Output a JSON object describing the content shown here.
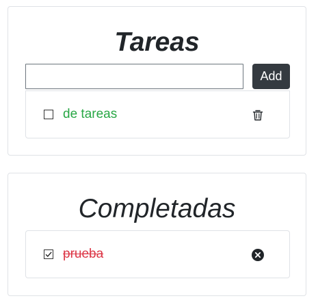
{
  "pending": {
    "title": "Tareas",
    "input": {
      "value": "",
      "placeholder": ""
    },
    "add_label": "Add",
    "items": [
      {
        "text": "de tareas",
        "checked": false,
        "action_icon": "trash-icon"
      }
    ]
  },
  "completed": {
    "title": "Completadas",
    "items": [
      {
        "text": "prueba",
        "checked": true,
        "action_icon": "remove-circle-icon"
      }
    ]
  },
  "colors": {
    "pending_text": "#28a745",
    "done_text": "#dc3545",
    "button_bg": "#343a40"
  }
}
